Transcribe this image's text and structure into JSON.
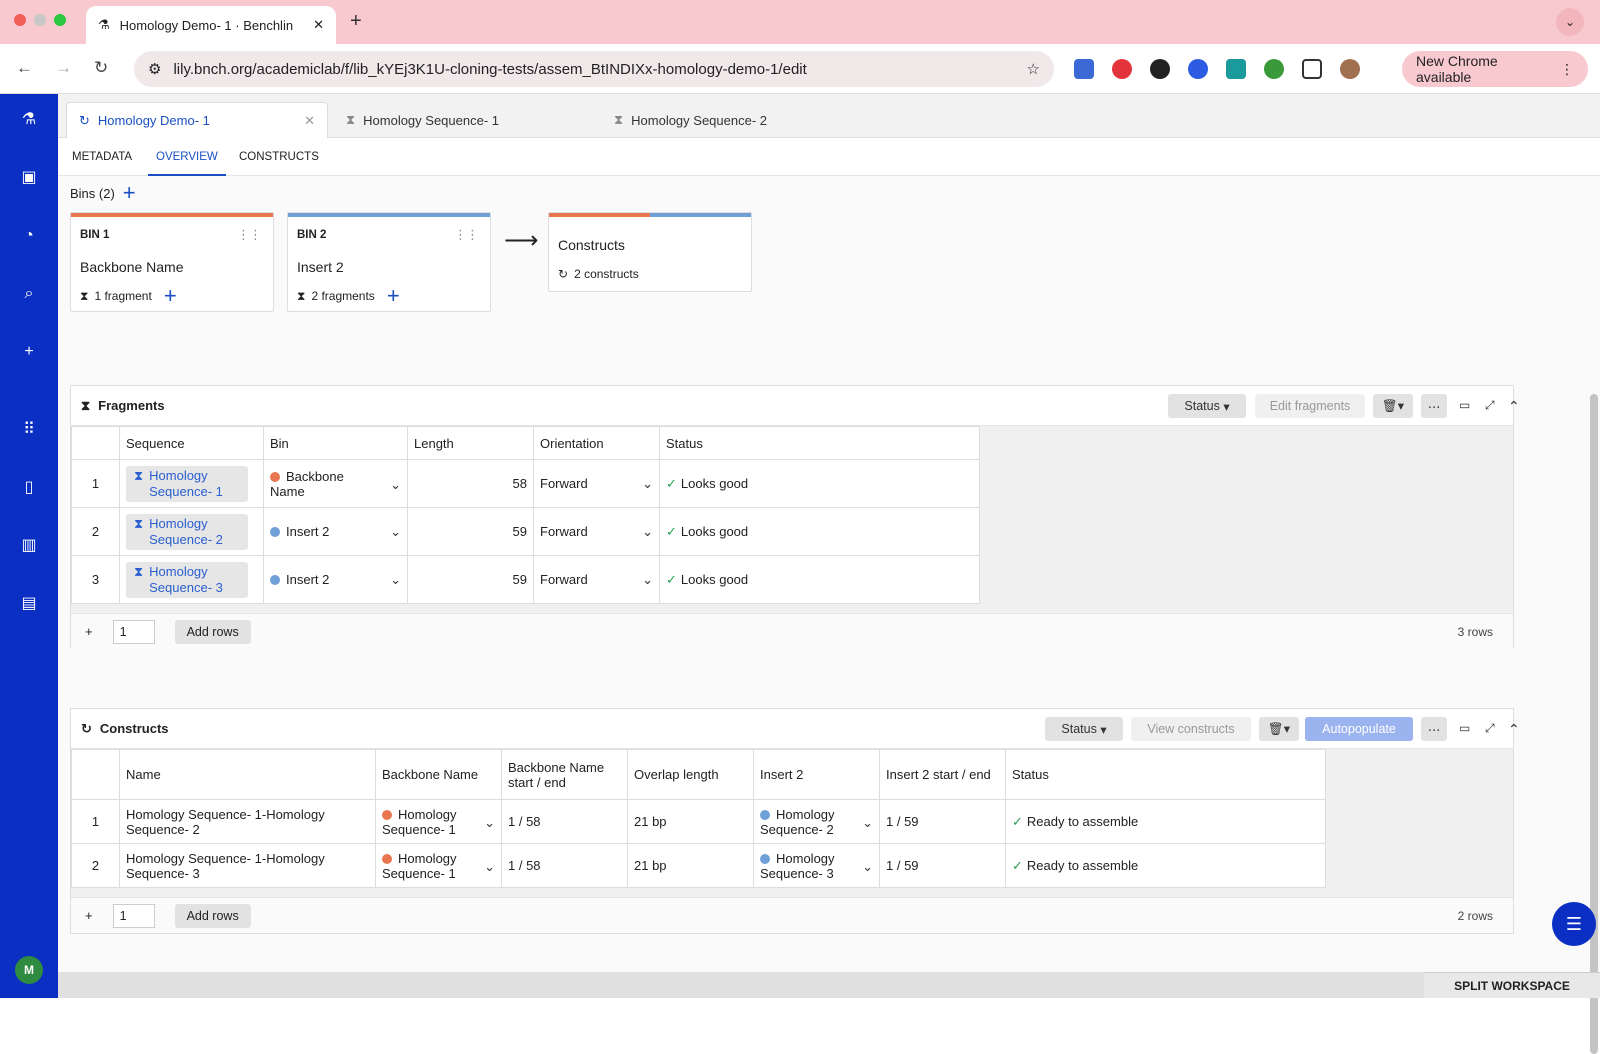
{
  "browser": {
    "tab_title": "Homology Demo- 1 · Benchlin",
    "url": "lily.bnch.org/academiclab/f/lib_kYEj3K1U-cloning-tests/assem_BtINDIXx-homology-demo-1/edit",
    "new_chrome": "New Chrome available"
  },
  "doc_tabs": [
    {
      "label": "Homology Demo- 1"
    },
    {
      "label": "Homology Sequence- 1"
    },
    {
      "label": "Homology Sequence- 2"
    }
  ],
  "sub_tabs": [
    "METADATA",
    "OVERVIEW",
    "CONSTRUCTS"
  ],
  "bins": {
    "label": "Bins (2)",
    "cards": [
      {
        "tag": "BIN 1",
        "name": "Backbone Name",
        "frag": "1 fragment",
        "color": "#e8774f"
      },
      {
        "tag": "BIN 2",
        "name": "Insert 2",
        "frag": "2 fragments",
        "color": "#6fa0d8"
      }
    ],
    "constructs": {
      "title": "Constructs",
      "count": "2 constructs"
    }
  },
  "fragments": {
    "title": "Fragments",
    "status_btn": "Status",
    "edit_btn": "Edit fragments",
    "headers": [
      "Sequence",
      "Bin",
      "Length",
      "Orientation",
      "Status"
    ],
    "rows": [
      {
        "n": "1",
        "seq1": "Homology",
        "seq2": "Sequence- 1",
        "bin1": "Backbone",
        "bin2": "Name",
        "len": "58",
        "orient": "Forward",
        "status": "Looks good"
      },
      {
        "n": "2",
        "seq1": "Homology",
        "seq2": "Sequence- 2",
        "bin1": "Insert 2",
        "bin2": "",
        "len": "59",
        "orient": "Forward",
        "status": "Looks good"
      },
      {
        "n": "3",
        "seq1": "Homology",
        "seq2": "Sequence- 3",
        "bin1": "Insert 2",
        "bin2": "",
        "len": "59",
        "orient": "Forward",
        "status": "Looks good"
      }
    ],
    "add_value": "1",
    "add_rows": "Add rows",
    "row_count": "3 rows"
  },
  "constructs": {
    "title": "Constructs",
    "status_btn": "Status",
    "view_btn": "View constructs",
    "auto_btn": "Autopopulate",
    "headers": [
      "Name",
      "Backbone Name",
      "Backbone Name start / end",
      "Overlap length",
      "Insert 2",
      "Insert 2 start / end",
      "Status"
    ],
    "rows": [
      {
        "n": "1",
        "name1": "Homology Sequence- 1-Homology",
        "name2": "Sequence- 2",
        "bb1": "Homology",
        "bb2": "Sequence- 1",
        "bbse": "1 / 58",
        "overlap": "21 bp",
        "ins1": "Homology",
        "ins2": "Sequence- 2",
        "insse": "1 / 59",
        "status": "Ready to assemble"
      },
      {
        "n": "2",
        "name1": "Homology Sequence- 1-Homology",
        "name2": "Sequence- 3",
        "bb1": "Homology",
        "bb2": "Sequence- 1",
        "bbse": "1 / 58",
        "overlap": "21 bp",
        "ins1": "Homology",
        "ins2": "Sequence- 3",
        "insse": "1 / 59",
        "status": "Ready to assemble"
      }
    ],
    "add_value": "1",
    "add_rows": "Add rows",
    "row_count": "2 rows"
  },
  "footer": {
    "split": "SPLIT WORKSPACE"
  },
  "user": {
    "initial": "M"
  }
}
